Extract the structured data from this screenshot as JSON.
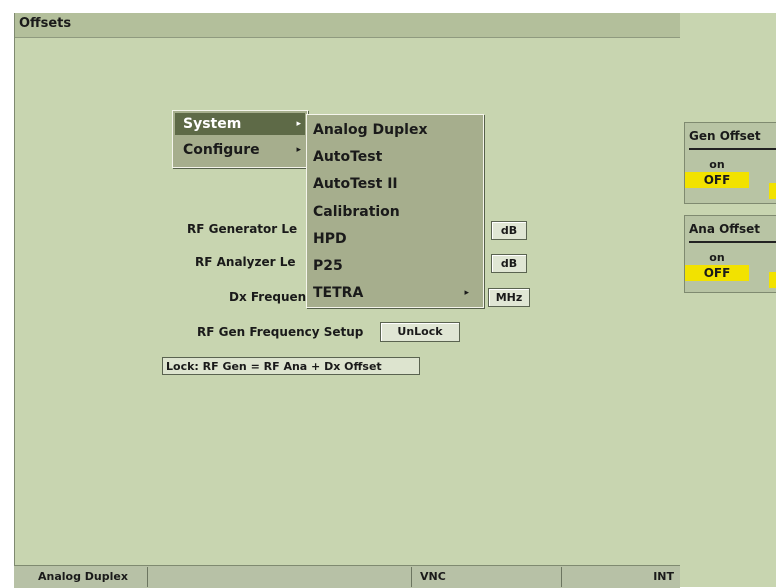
{
  "window": {
    "title": "Offsets"
  },
  "context_menu": {
    "items": [
      {
        "label": "System",
        "submenu_arrow": "▸"
      },
      {
        "label": "Configure",
        "submenu_arrow": "▸"
      }
    ],
    "submenu": {
      "items": [
        {
          "label": "Analog Duplex"
        },
        {
          "label": "AutoTest"
        },
        {
          "label": "AutoTest II"
        },
        {
          "label": "Calibration"
        },
        {
          "label": "HPD"
        },
        {
          "label": "P25"
        },
        {
          "label": "TETRA",
          "submenu_arrow": "▸"
        }
      ]
    }
  },
  "settings": {
    "rf_gen_level": {
      "label": "RF Generator Le",
      "unit": "dB"
    },
    "rf_ana_level": {
      "label": "RF Analyzer Le",
      "unit": "dB"
    },
    "dx_frequency": {
      "label": "Dx Frequen",
      "unit": "MHz"
    },
    "rf_gen_freq_setup": {
      "label": "RF Gen Frequency Setup",
      "button": "UnLock"
    },
    "lock_note": "Lock: RF Gen = RF Ana + Dx Offset"
  },
  "side_panels": [
    {
      "title": "Gen Offset",
      "on": "on",
      "off": "OFF"
    },
    {
      "title": "Ana Offset",
      "on": "on",
      "off": "OFF"
    }
  ],
  "status_bar": {
    "mode": "Analog Duplex",
    "middle": "",
    "connection": "VNC",
    "source": "INT"
  },
  "colors": {
    "background": "#c8d5b0",
    "off_toggle": "#f2e200",
    "menu_selected": "#5e6a47"
  }
}
